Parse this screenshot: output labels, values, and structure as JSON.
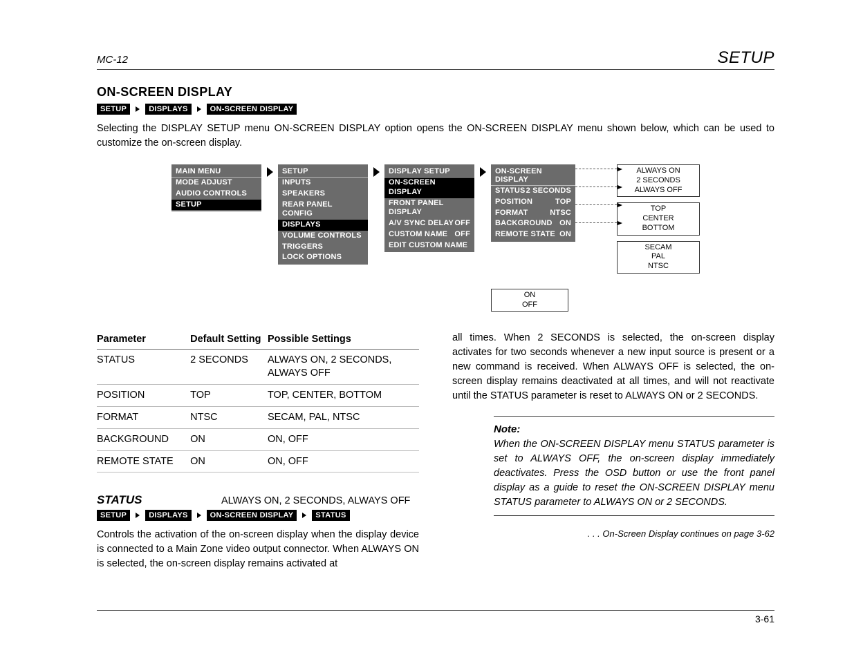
{
  "header": {
    "left": "MC-12",
    "right": "SETUP"
  },
  "section_title": "ON-SCREEN DISPLAY",
  "crumbs1": [
    "SETUP",
    "DISPLAYS",
    "ON-SCREEN DISPLAY"
  ],
  "intro": "Selecting the DISPLAY SETUP menu ON-SCREEN DISPLAY option opens the ON-SCREEN DISPLAY menu shown below, which can be used to customize the on-screen display.",
  "diagram": {
    "main_menu": {
      "title": "MAIN MENU",
      "items": [
        "MODE ADJUST",
        "AUDIO CONTROLS",
        "SETUP"
      ],
      "highlighted": 2
    },
    "setup": {
      "title": "SETUP",
      "items": [
        "INPUTS",
        "SPEAKERS",
        "REAR PANEL CONFIG",
        "DISPLAYS",
        "VOLUME CONTROLS",
        "TRIGGERS",
        "LOCK OPTIONS"
      ],
      "highlighted": 3
    },
    "display_setup": {
      "title": "DISPLAY SETUP",
      "items": [
        {
          "label": "ON-SCREEN DISPLAY"
        },
        {
          "label": "FRONT PANEL DISPLAY"
        },
        {
          "label": "A/V SYNC DELAY",
          "value": "OFF"
        },
        {
          "label": "CUSTOM NAME",
          "value": "OFF"
        },
        {
          "label": "EDIT CUSTOM NAME"
        }
      ],
      "highlighted": 0
    },
    "osd": {
      "title": "ON-SCREEN DISPLAY",
      "items": [
        {
          "label": "STATUS",
          "value": "2 SECONDS"
        },
        {
          "label": "POSITION",
          "value": "TOP"
        },
        {
          "label": "FORMAT",
          "value": "NTSC"
        },
        {
          "label": "BACKGROUND",
          "value": "ON"
        },
        {
          "label": "REMOTE STATE",
          "value": "ON"
        }
      ]
    },
    "options": {
      "status": [
        "ALWAYS ON",
        "2 SECONDS",
        "ALWAYS OFF"
      ],
      "position": [
        "TOP",
        "CENTER",
        "BOTTOM"
      ],
      "format": [
        "SECAM",
        "PAL",
        "NTSC"
      ],
      "onoff": [
        "ON",
        "OFF"
      ]
    }
  },
  "table": {
    "headers": [
      "Parameter",
      "Default Setting",
      "Possible Settings"
    ],
    "rows": [
      [
        "STATUS",
        "2 SECONDS",
        "ALWAYS ON, 2 SECONDS, ALWAYS OFF"
      ],
      [
        "POSITION",
        "TOP",
        "TOP, CENTER, BOTTOM"
      ],
      [
        "FORMAT",
        "NTSC",
        "SECAM, PAL, NTSC"
      ],
      [
        "BACKGROUND",
        "ON",
        "ON, OFF"
      ],
      [
        "REMOTE STATE",
        "ON",
        "ON, OFF"
      ]
    ]
  },
  "status_param": {
    "name": "STATUS",
    "values": "ALWAYS ON, 2 SECONDS, ALWAYS OFF",
    "crumbs": [
      "SETUP",
      "DISPLAYS",
      "ON-SCREEN DISPLAY",
      "STATUS"
    ],
    "desc_left": "Controls the activation of the on-screen display when the display device is connected to a Main Zone video output connector. When ALWAYS ON is selected, the on-screen display remains activated at",
    "desc_right": "all times. When 2 SECONDS is selected, the on-screen display activates for two seconds whenever a new input source is present or a new command is received. When ALWAYS OFF is selected, the on-screen display remains deactivated at all times, and will not reactivate until the STATUS parameter is reset to ALWAYS ON or 2 SECONDS."
  },
  "note": {
    "title": "Note:",
    "body": "When the ON-SCREEN DISPLAY menu STATUS parameter is set to ALWAYS OFF, the on-screen display immediately deactivates. Press the OSD button or use the front panel display as a guide to reset the ON-SCREEN DISPLAY menu STATUS parameter to ALWAYS ON or 2 SECONDS."
  },
  "continues": ". . . On-Screen Display continues on page 3-62",
  "page_number": "3-61"
}
